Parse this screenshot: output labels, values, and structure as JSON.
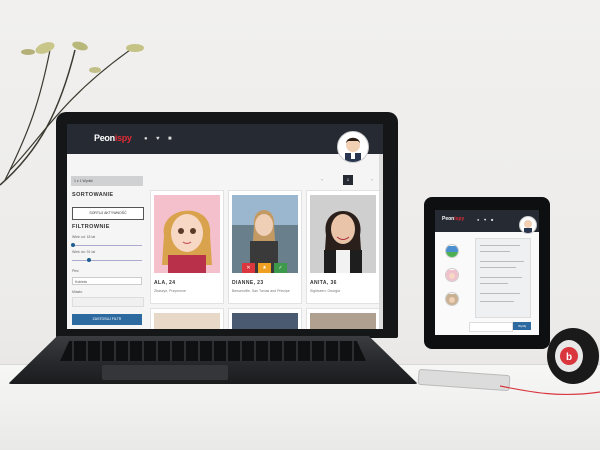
{
  "site": {
    "logo_part1": "Peon",
    "logo_part2": "ispy",
    "results_label": "1 z 1 Wyniki",
    "pagination": {
      "prev": "‹",
      "current": "1",
      "next": "›"
    }
  },
  "sidebar": {
    "sort_title": "SORTOWANIE",
    "sort_button": "SORTUJ AKTYWNOŚĆ",
    "filter_title": "FILTROWNIE",
    "age_from_label": "Wiek od: 18 lat",
    "age_to_label": "Wiek do: 91 lat",
    "sex_label": "Płeć",
    "sex_value": "Kobieta",
    "city_label": "Miasto",
    "filter_button": "ZASTOSUJ FILTR"
  },
  "profiles": [
    {
      "name": "ALA, 24",
      "location": "Zbaszyn, Przymorze"
    },
    {
      "name": "DIANNE, 23",
      "location": "Bensenville, San Tomas and Principe"
    },
    {
      "name": "ANITA, 36",
      "location": "Sightseen, Georgia"
    }
  ],
  "colors": {
    "header_bg": "#252a33",
    "accent_blue": "#2d6a9f",
    "action_red": "#d9363e",
    "action_yellow": "#f0a020",
    "action_green": "#3c9a4a",
    "logo_red": "#e02b35"
  },
  "icons": {
    "user": "user-icon",
    "heart": "heart-icon",
    "chat": "chat-icon"
  },
  "tablet": {
    "send_button": "Wyślij"
  }
}
